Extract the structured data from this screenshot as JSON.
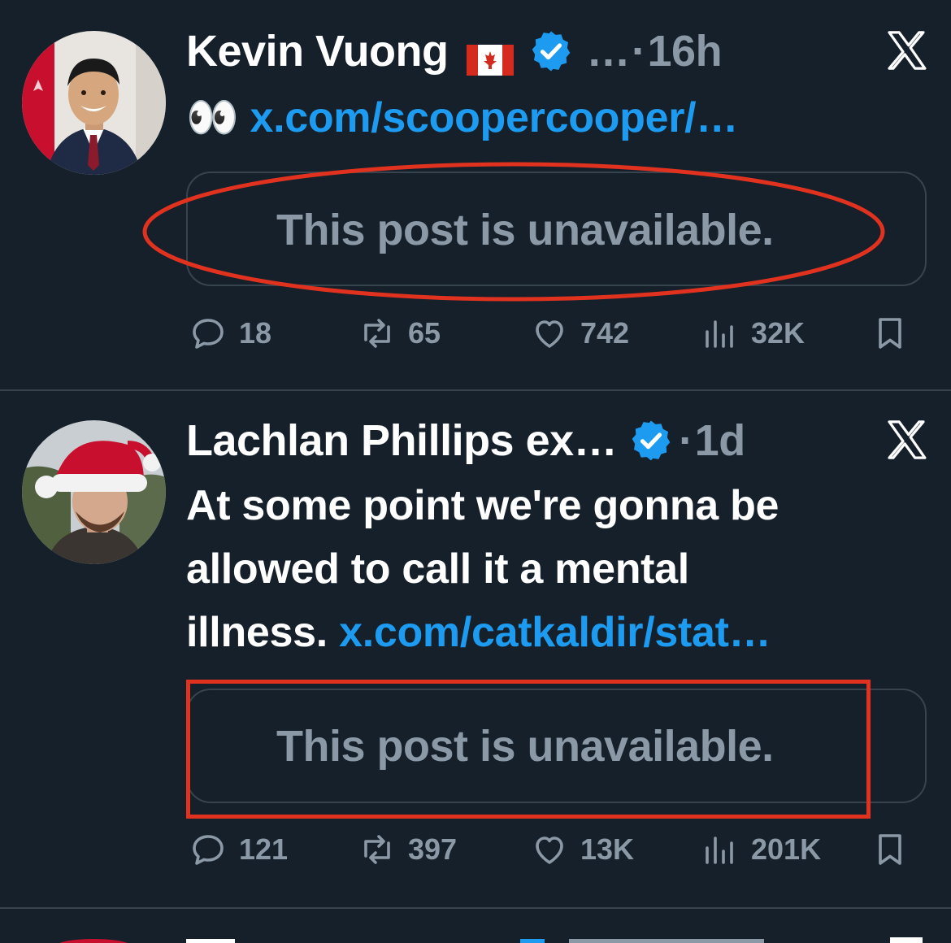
{
  "posts": [
    {
      "author": "Kevin Vuong",
      "flag": "🇨🇦",
      "handle_truncated": "…",
      "separator": "·",
      "time": "16h",
      "emoji": "👀",
      "link": "x.com/scoopercooper/…",
      "quote_text": "This post is unavailable.",
      "replies": "18",
      "reposts": "65",
      "likes": "742",
      "views": "32K"
    },
    {
      "author": "Lachlan Phillips ex…",
      "separator": "·",
      "time": "1d",
      "text_line1": "At some point we're gonna be",
      "text_line2": "allowed to call it a mental",
      "text_line3_prefix": "illness.",
      "link": "x.com/catkaldir/stat…",
      "quote_text": "This post is unavailable.",
      "replies": "121",
      "reposts": "397",
      "likes": "13K",
      "views": "201K"
    }
  ],
  "icons": {
    "verified": "verified-badge-icon",
    "close": "x-close-icon",
    "reply": "reply-bubble-icon",
    "repost": "repost-arrows-icon",
    "like": "heart-icon",
    "views": "bar-chart-icon",
    "bookmark": "bookmark-icon"
  },
  "colors": {
    "background": "#15202b",
    "text": "#ffffff",
    "secondary_text": "#8b98a5",
    "link": "#1d9bf0",
    "verified": "#1d9bf0",
    "border": "#38444d",
    "annotation_red": "#e0321f"
  }
}
